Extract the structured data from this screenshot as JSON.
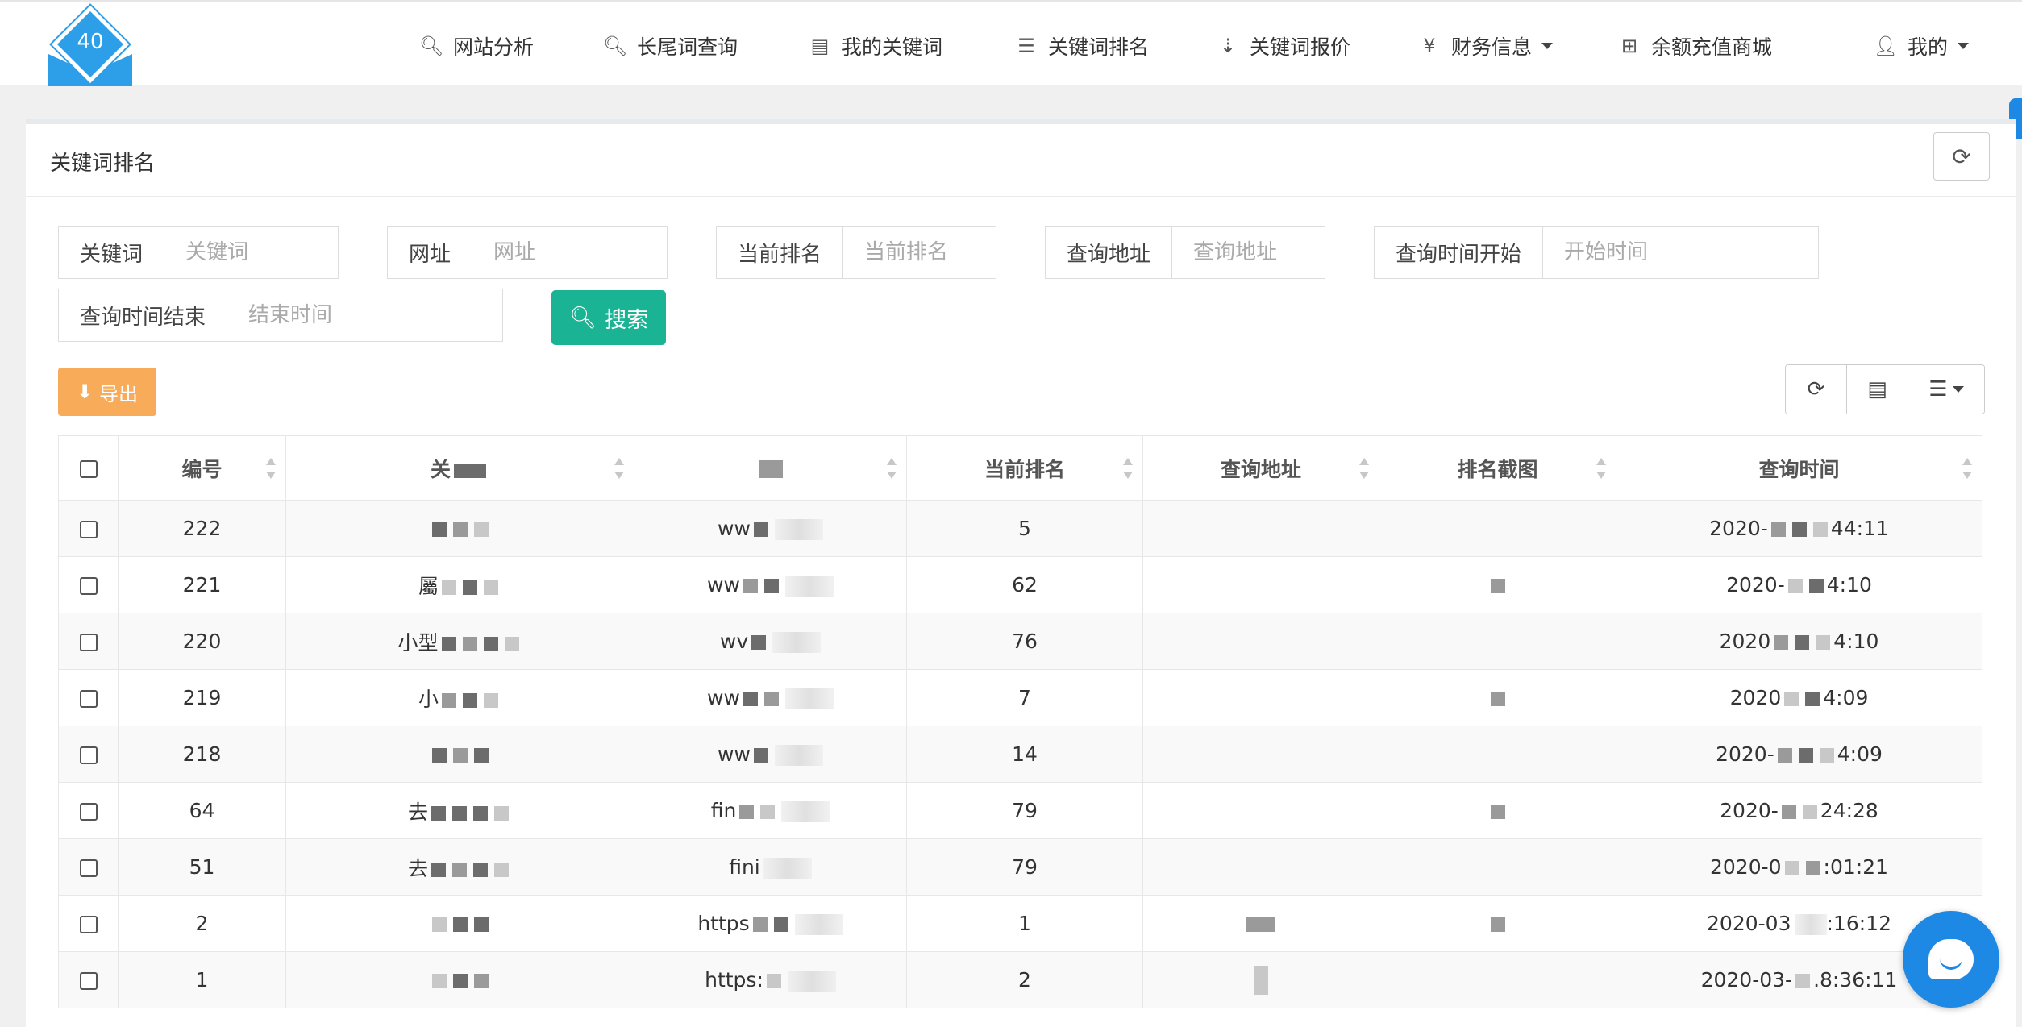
{
  "logo": {
    "text": "40"
  },
  "nav": {
    "items": [
      {
        "label": "网站分析",
        "icon": "search-icon",
        "glyph": "🔍︎"
      },
      {
        "label": "长尾词查询",
        "icon": "search-icon",
        "glyph": "🔍︎"
      },
      {
        "label": "我的关键词",
        "icon": "list-alt-icon",
        "glyph": "▤"
      },
      {
        "label": "关键词排名",
        "icon": "list-ol-icon",
        "glyph": "☰"
      },
      {
        "label": "关键词报价",
        "icon": "sort-numeric-icon",
        "glyph": "⇣"
      },
      {
        "label": "财务信息",
        "icon": "yen-icon",
        "glyph": "¥"
      },
      {
        "label": "余额充值商城",
        "icon": "plus-square-icon",
        "glyph": "⊞"
      },
      {
        "label": "我的",
        "icon": "user-icon",
        "glyph": "👤︎"
      }
    ]
  },
  "panel": {
    "title": "关键词排名"
  },
  "filters": {
    "keyword": {
      "label": "关键词",
      "placeholder": "关键词"
    },
    "url": {
      "label": "网址",
      "placeholder": "网址"
    },
    "rank": {
      "label": "当前排名",
      "placeholder": "当前排名"
    },
    "query_addr": {
      "label": "查询地址",
      "placeholder": "查询地址"
    },
    "start_time": {
      "label": "查询时间开始",
      "placeholder": "开始时间"
    },
    "end_time": {
      "label": "查询时间结束",
      "placeholder": "结束时间"
    },
    "search_label": "搜索"
  },
  "export_label": "导出",
  "table": {
    "headers": [
      "编号",
      "关",
      "",
      "当前排名",
      "查询地址",
      "排名截图",
      "查询时间"
    ],
    "rows": [
      {
        "id": "222",
        "kw": "",
        "url": "ww",
        "rank": "5",
        "addr": "",
        "time_a": "2020-",
        "time_b": "44:11"
      },
      {
        "id": "221",
        "kw": "屬",
        "url": "ww",
        "rank": "62",
        "addr": "",
        "time_a": "2020-",
        "time_b": "4:10"
      },
      {
        "id": "220",
        "kw": "小型",
        "url": "wv",
        "rank": "76",
        "addr": "",
        "time_a": "2020",
        "time_b": "4:10"
      },
      {
        "id": "219",
        "kw": "小",
        "url": "ww",
        "rank": "7",
        "addr": "",
        "time_a": "2020",
        "time_b": "4:09"
      },
      {
        "id": "218",
        "kw": "",
        "url": "ww",
        "rank": "14",
        "addr": "",
        "time_a": "2020-",
        "time_b": "4:09"
      },
      {
        "id": "64",
        "kw": "去",
        "url": "fin",
        "rank": "79",
        "addr": "",
        "time_a": "2020-",
        "time_b": "24:28"
      },
      {
        "id": "51",
        "kw": "去",
        "url": "fini",
        "rank": "79",
        "addr": "",
        "time_a": "2020-0",
        "time_b": ":01:21"
      },
      {
        "id": "2",
        "kw": "",
        "url": "https",
        "rank": "1",
        "addr": "",
        "time_a": "2020-03",
        "time_b": ":16:12"
      },
      {
        "id": "1",
        "kw": "",
        "url": "https:",
        "rank": "2",
        "addr": "",
        "time_a": "2020-03-",
        "time_b": ".8:36:11"
      }
    ]
  },
  "colors": {
    "search_btn": "#1ab394",
    "export_btn": "#f8ac59",
    "logo": "#2d9ee8",
    "chat": "#1e88e5"
  }
}
